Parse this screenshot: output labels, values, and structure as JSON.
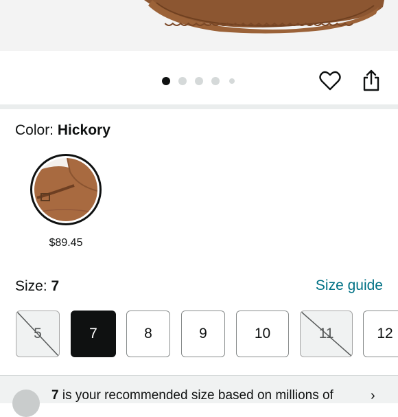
{
  "image_carousel": {
    "dot_count": 5,
    "active_index": 0
  },
  "actions": {
    "favorite_icon": "heart-icon",
    "share_icon": "share-icon"
  },
  "color": {
    "label": "Color: ",
    "value": "Hickory",
    "swatches": [
      {
        "name": "Hickory",
        "price": "$89.45",
        "selected": true
      }
    ]
  },
  "size": {
    "label": "Size: ",
    "value": "7",
    "guide_link": "Size guide",
    "options": [
      {
        "label": "5",
        "state": "unavailable"
      },
      {
        "label": "7",
        "state": "selected"
      },
      {
        "label": "8",
        "state": "available"
      },
      {
        "label": "9",
        "state": "available"
      },
      {
        "label": "10",
        "state": "available"
      },
      {
        "label": "11",
        "state": "unavailable"
      },
      {
        "label": "12",
        "state": "available"
      }
    ]
  },
  "recommendation": {
    "size": "7",
    "text": " is your recommended size based on millions of"
  },
  "colors": {
    "link": "#007185",
    "selected": "#0f1111",
    "product_brown": "#a86a40"
  }
}
